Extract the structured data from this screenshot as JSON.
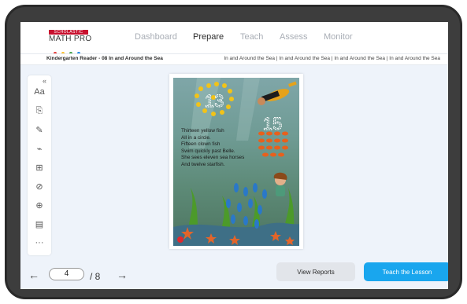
{
  "app": {
    "logo": {
      "badge": "SCHOLASTIC",
      "name": "MATH PRO"
    },
    "nav": [
      {
        "label": "Dashboard",
        "active": false
      },
      {
        "label": "Prepare",
        "active": true
      },
      {
        "label": "Teach",
        "active": false
      },
      {
        "label": "Assess",
        "active": false
      },
      {
        "label": "Monitor",
        "active": false
      }
    ]
  },
  "breadcrumb": {
    "title": "Kindergarten Reader - 08 In and Around the Sea",
    "path": "In and Around the Sea  |  In and Around the Sea | In and Around the Sea | In and Around the Sea"
  },
  "toolbar": {
    "collapse": "«",
    "tools": [
      {
        "icon": "font-size-icon",
        "glyph": "Aa"
      },
      {
        "icon": "annotate-icon",
        "glyph": "⎘"
      },
      {
        "icon": "pencil-icon",
        "glyph": "✎"
      },
      {
        "icon": "highlighter-icon",
        "glyph": "⌁"
      },
      {
        "icon": "grid-icon",
        "glyph": "⊞"
      },
      {
        "icon": "hide-icon",
        "glyph": "⊘"
      },
      {
        "icon": "zoom-icon",
        "glyph": "⊕"
      },
      {
        "icon": "reader-icon",
        "glyph": "▤"
      },
      {
        "icon": "more-icon",
        "glyph": "···"
      }
    ]
  },
  "book": {
    "poem": [
      "Thirteen yellow fish",
      "All in a circle.",
      "Fifteen clown fish",
      "Swim quickly past Belle.",
      "She sees eleven sea horses",
      "And twelve starfish."
    ],
    "numerals": [
      "13",
      "15"
    ]
  },
  "pager": {
    "prev": "←",
    "current": "4",
    "total": "/ 8",
    "next": "→"
  },
  "actions": {
    "reports": "View Reports",
    "teach": "Teach the Lesson"
  },
  "colors": {
    "accent": "#19a6ee",
    "brand": "#c8102e",
    "background": "#eef3fa"
  }
}
